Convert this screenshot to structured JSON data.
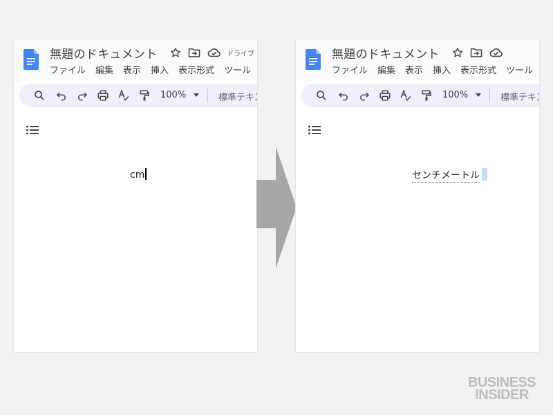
{
  "doc": {
    "title": "無題のドキュメント",
    "drive_label": "ドライブ"
  },
  "menu": [
    "ファイル",
    "編集",
    "表示",
    "挿入",
    "表示形式",
    "ツール"
  ],
  "toolbar": {
    "zoom": "100%",
    "style": "標準テキスト"
  },
  "before": {
    "typed_text": "cm"
  },
  "after": {
    "converted_text": "センチメートル"
  },
  "watermark": {
    "line1": "BUSINESS",
    "line2": "INSIDER"
  },
  "colors": {
    "page_background": "#f2f2f2",
    "doc_blue": "#4285f4",
    "toolbar_bg": "#edf2fa",
    "arrow_gray": "#a6a6a6",
    "suggestion_highlight": "#c6dafc"
  }
}
